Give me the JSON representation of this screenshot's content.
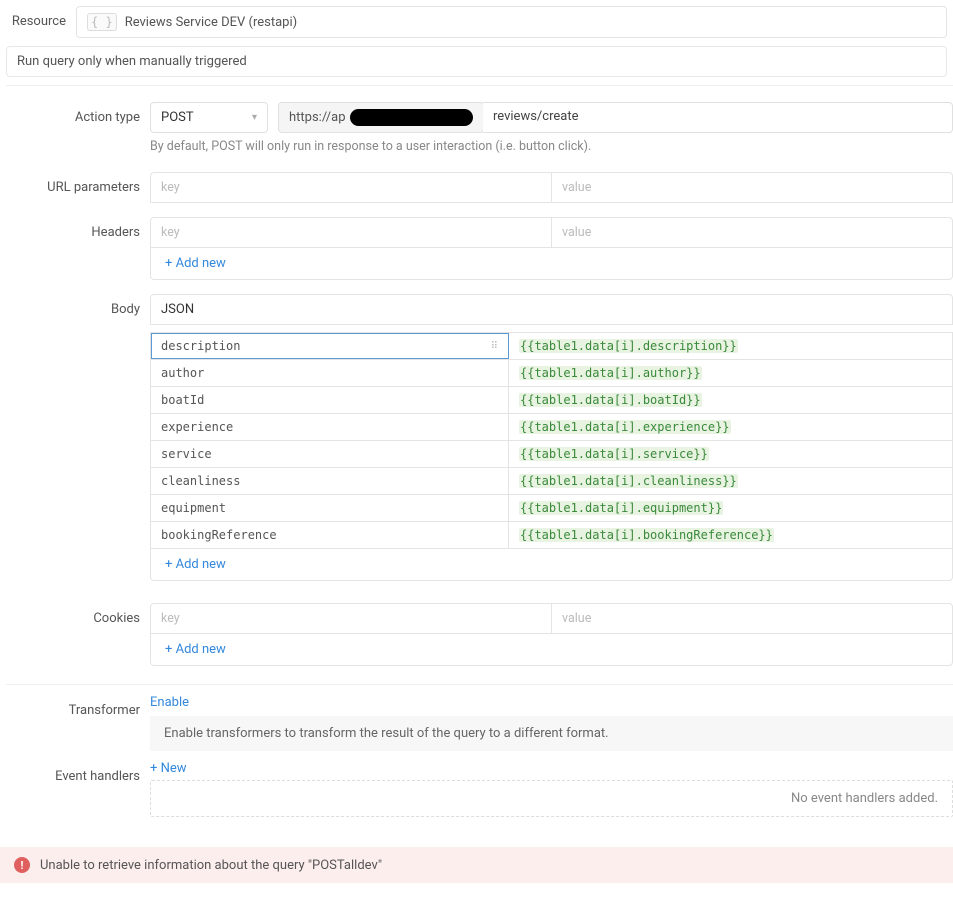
{
  "resource": {
    "label": "Resource",
    "value": "Reviews Service DEV (restapi)"
  },
  "trigger": "Run query only when manually triggered",
  "action": {
    "label": "Action type",
    "method": "POST",
    "url_prefix": "https://ap",
    "path": "reviews/create",
    "hint": "By default, POST will only run in response to a user interaction (i.e. button click)."
  },
  "urlParams": {
    "label": "URL parameters",
    "key_ph": "key",
    "val_ph": "value"
  },
  "headers": {
    "label": "Headers",
    "key_ph": "key",
    "val_ph": "value",
    "addnew": "+ Add new"
  },
  "body": {
    "label": "Body",
    "type": "JSON",
    "rows": [
      {
        "k": "description",
        "v": "{{table1.data[i].description}}"
      },
      {
        "k": "author",
        "v": "{{table1.data[i].author}}"
      },
      {
        "k": "boatId",
        "v": "{{table1.data[i].boatId}}"
      },
      {
        "k": "experience",
        "v": "{{table1.data[i].experience}}"
      },
      {
        "k": "service",
        "v": "{{table1.data[i].service}}"
      },
      {
        "k": "cleanliness",
        "v": "{{table1.data[i].cleanliness}}"
      },
      {
        "k": "equipment",
        "v": "{{table1.data[i].equipment}}"
      },
      {
        "k": "bookingReference",
        "v": "{{table1.data[i].bookingReference}}"
      }
    ],
    "addnew": "+ Add new"
  },
  "cookies": {
    "label": "Cookies",
    "key_ph": "key",
    "val_ph": "value",
    "addnew": "+ Add new"
  },
  "transformer": {
    "label": "Transformer",
    "enable": "Enable",
    "desc": "Enable transformers to transform the result of the query to a different format."
  },
  "eventHandlers": {
    "label": "Event handlers",
    "new": "+ New",
    "empty": "No event handlers added."
  },
  "error": "Unable to retrieve information about the query \"POSTalldev\""
}
